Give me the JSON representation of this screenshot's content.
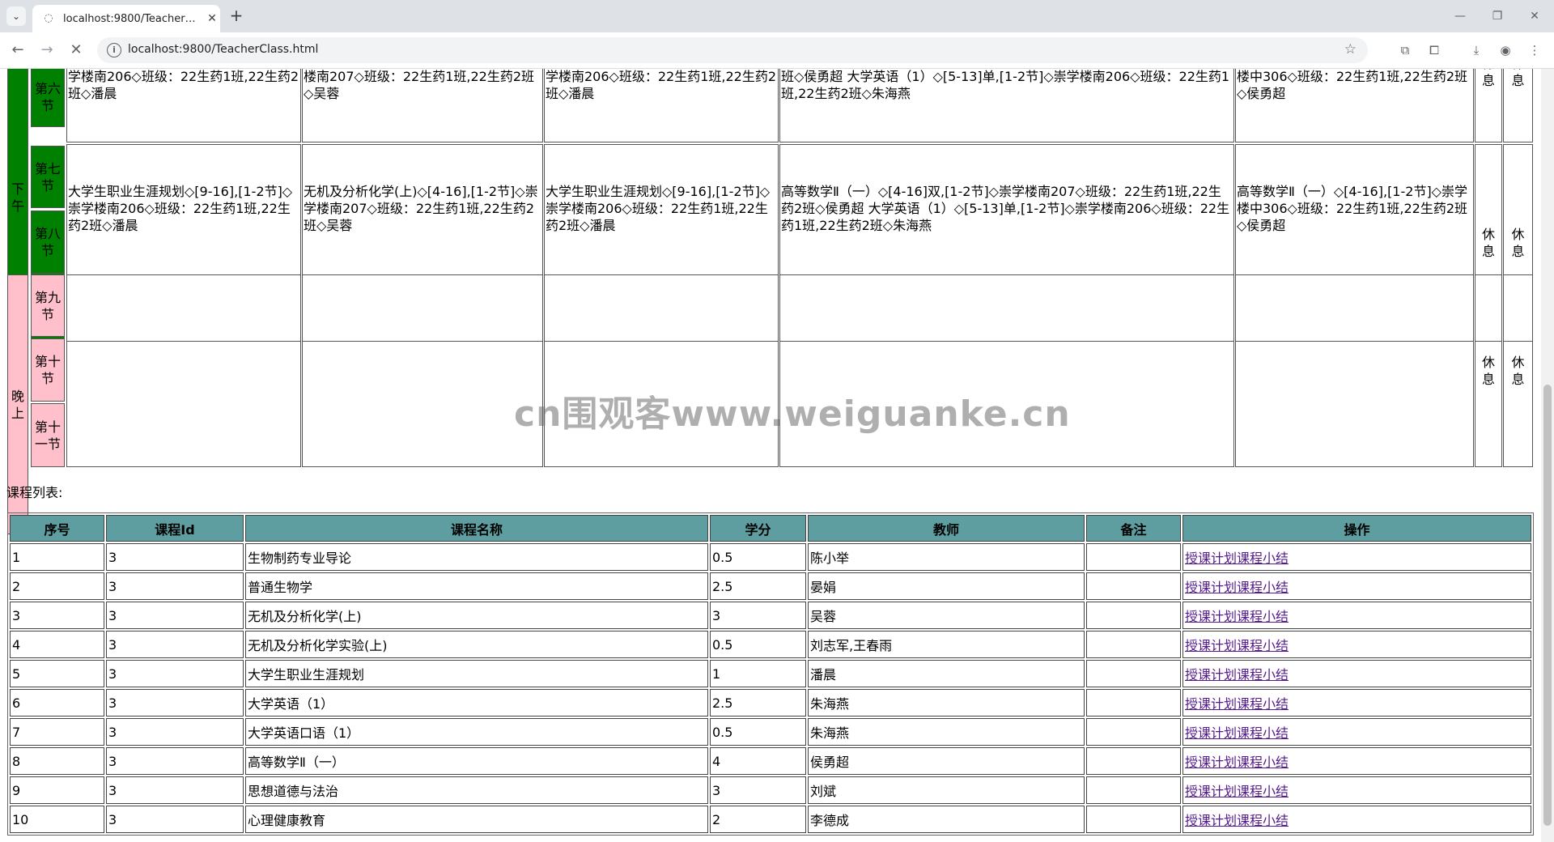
{
  "browser": {
    "tab_title": "localhost:9800/TeacherClass.html",
    "url": "localhost:9800/TeacherClass.html"
  },
  "timetable": {
    "periods": {
      "afternoon": "下午",
      "evening": "晚上"
    },
    "sessions": {
      "p6": "第六节",
      "p7": "第七节",
      "p8": "第八节",
      "p9": "第九节",
      "p10": "第十节",
      "p11": "第十一节"
    },
    "row_cut": {
      "mon": "学楼南206◇班级：22生药1班,22生药2班◇潘晨",
      "tue": "楼南207◇班级：22生药1班,22生药2班◇吴蓉",
      "wed": "学楼南206◇班级：22生药1班,22生药2班◇潘晨",
      "thu": "班◇侯勇超 大学英语（1）◇[5-13]单,[1-2节]◇崇学楼南206◇班级：22生药1班,22生药2班◇朱海燕",
      "fri": "楼中306◇班级：22生药1班,22生药2班◇侯勇超"
    },
    "row_78": {
      "mon": "大学生职业生涯规划◇[9-16],[1-2节]◇崇学楼南206◇班级：22生药1班,22生药2班◇潘晨",
      "tue": "无机及分析化学(上)◇[4-16],[1-2节]◇崇学楼南207◇班级：22生药1班,22生药2班◇吴蓉",
      "wed": "大学生职业生涯规划◇[9-16],[1-2节]◇崇学楼南206◇班级：22生药1班,22生药2班◇潘晨",
      "thu": "高等数学Ⅱ（一）◇[4-16]双,[1-2节]◇崇学楼南207◇班级：22生药1班,22生药2班◇侯勇超 大学英语（1）◇[5-13]单,[1-2节]◇崇学楼南206◇班级：22生药1班,22生药2班◇朱海燕",
      "fri": "高等数学Ⅱ（一）◇[4-16],[1-2节]◇崇学楼中306◇班级：22生药1班,22生药2班◇侯勇超"
    },
    "rest_label": "休息"
  },
  "course_list": {
    "label": "课程列表:",
    "headers": [
      "序号",
      "课程Id",
      "课程名称",
      "学分",
      "教师",
      "备注",
      "操作"
    ],
    "action_label": "授课计划课程小结",
    "rows": [
      {
        "no": "1",
        "id": "3",
        "name": "生物制药专业导论",
        "credit": "0.5",
        "teacher": "陈小举",
        "note": ""
      },
      {
        "no": "2",
        "id": "3",
        "name": "普通生物学",
        "credit": "2.5",
        "teacher": "晏娟",
        "note": ""
      },
      {
        "no": "3",
        "id": "3",
        "name": "无机及分析化学(上)",
        "credit": "3",
        "teacher": "吴蓉",
        "note": ""
      },
      {
        "no": "4",
        "id": "3",
        "name": "无机及分析化学实验(上)",
        "credit": "0.5",
        "teacher": "刘志军,王春雨",
        "note": ""
      },
      {
        "no": "5",
        "id": "3",
        "name": "大学生职业生涯规划",
        "credit": "1",
        "teacher": "潘晨",
        "note": ""
      },
      {
        "no": "6",
        "id": "3",
        "name": "大学英语（1）",
        "credit": "2.5",
        "teacher": "朱海燕",
        "note": ""
      },
      {
        "no": "7",
        "id": "3",
        "name": "大学英语口语（1）",
        "credit": "0.5",
        "teacher": "朱海燕",
        "note": ""
      },
      {
        "no": "8",
        "id": "3",
        "name": "高等数学Ⅱ（一）",
        "credit": "4",
        "teacher": "侯勇超",
        "note": ""
      },
      {
        "no": "9",
        "id": "3",
        "name": "思想道德与法治",
        "credit": "3",
        "teacher": "刘斌",
        "note": ""
      },
      {
        "no": "10",
        "id": "3",
        "name": "心理健康教育",
        "credit": "2",
        "teacher": "李德成",
        "note": ""
      }
    ]
  },
  "watermark": "cn围观客www.weiguanke.cn"
}
